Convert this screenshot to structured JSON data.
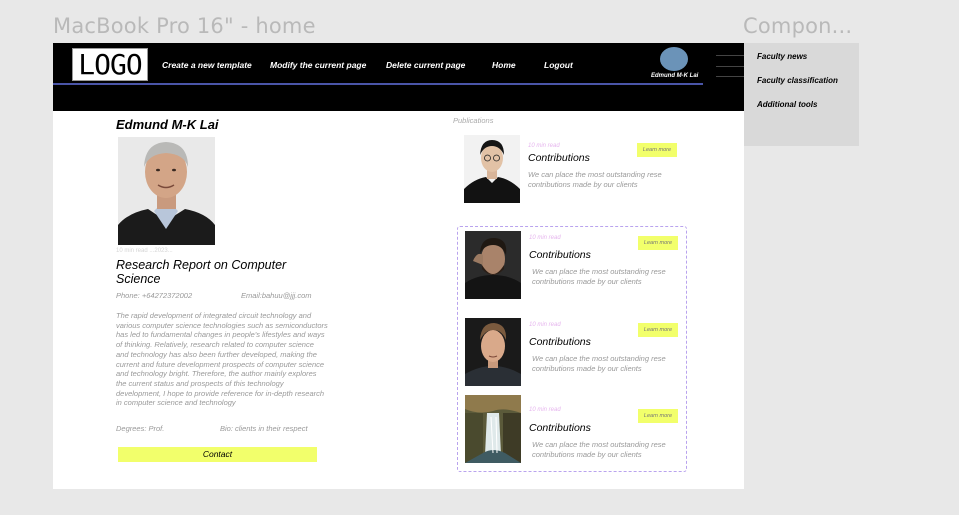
{
  "frames": {
    "home_title": "MacBook Pro 16\" - home",
    "component_title": "Compon..."
  },
  "header": {
    "logo_text": "LOGO",
    "nav": [
      "Create a new template",
      "Modify the current page",
      "Delete current page",
      "Home",
      "Logout"
    ],
    "username": "Edmund M-K Lai"
  },
  "dropdown": {
    "items": [
      "Faculty news",
      "Faculty  classification",
      "Additional tools"
    ]
  },
  "profile": {
    "name": "Edmund M-K Lai",
    "photo_caption": "10 min read  ...2023...",
    "report_title": "Research Report on Computer Science",
    "phone": "Phone: +64272372002",
    "email": "Email:bahuu@jjj.com",
    "description": "The rapid development of integrated circuit technology and various computer science technologies such as semiconductors has led to fundamental changes in people's lifestyles and ways of thinking. Relatively, research related to computer science and technology has also been further developed, making the current and future development prospects of computer science and technology bright. Therefore, the author mainly explores the current status and prospects of this technology development, I hope to provide reference for in-depth research in computer science and technology",
    "degrees": "Degrees: Prof.",
    "bio": "Bio: clients in their respect",
    "contact_label": "Contact"
  },
  "publications": {
    "label": "Publications",
    "items": [
      {
        "time": "10 min read",
        "title": "Contributions",
        "desc": "We can place the most outstanding rese contributions made by our clients",
        "button": "Learn more"
      },
      {
        "time": "10 min read",
        "title": "Contributions",
        "desc": "We can place the most outstanding rese contributions made by our clients",
        "button": "Learn more"
      },
      {
        "time": "10 min read",
        "title": "Contributions",
        "desc": "We can place the most outstanding rese contributions made by our clients",
        "button": "Learn more"
      },
      {
        "time": "10 min read",
        "title": "Contributions",
        "desc": "We can place the most outstanding rese contributions made by our clients",
        "button": "Learn more"
      }
    ]
  },
  "colors": {
    "accent_yellow": "#f2ff6b",
    "header_bg": "#000000",
    "avatar": "#6b93b8",
    "dashed_border": "#b9a3ee"
  }
}
